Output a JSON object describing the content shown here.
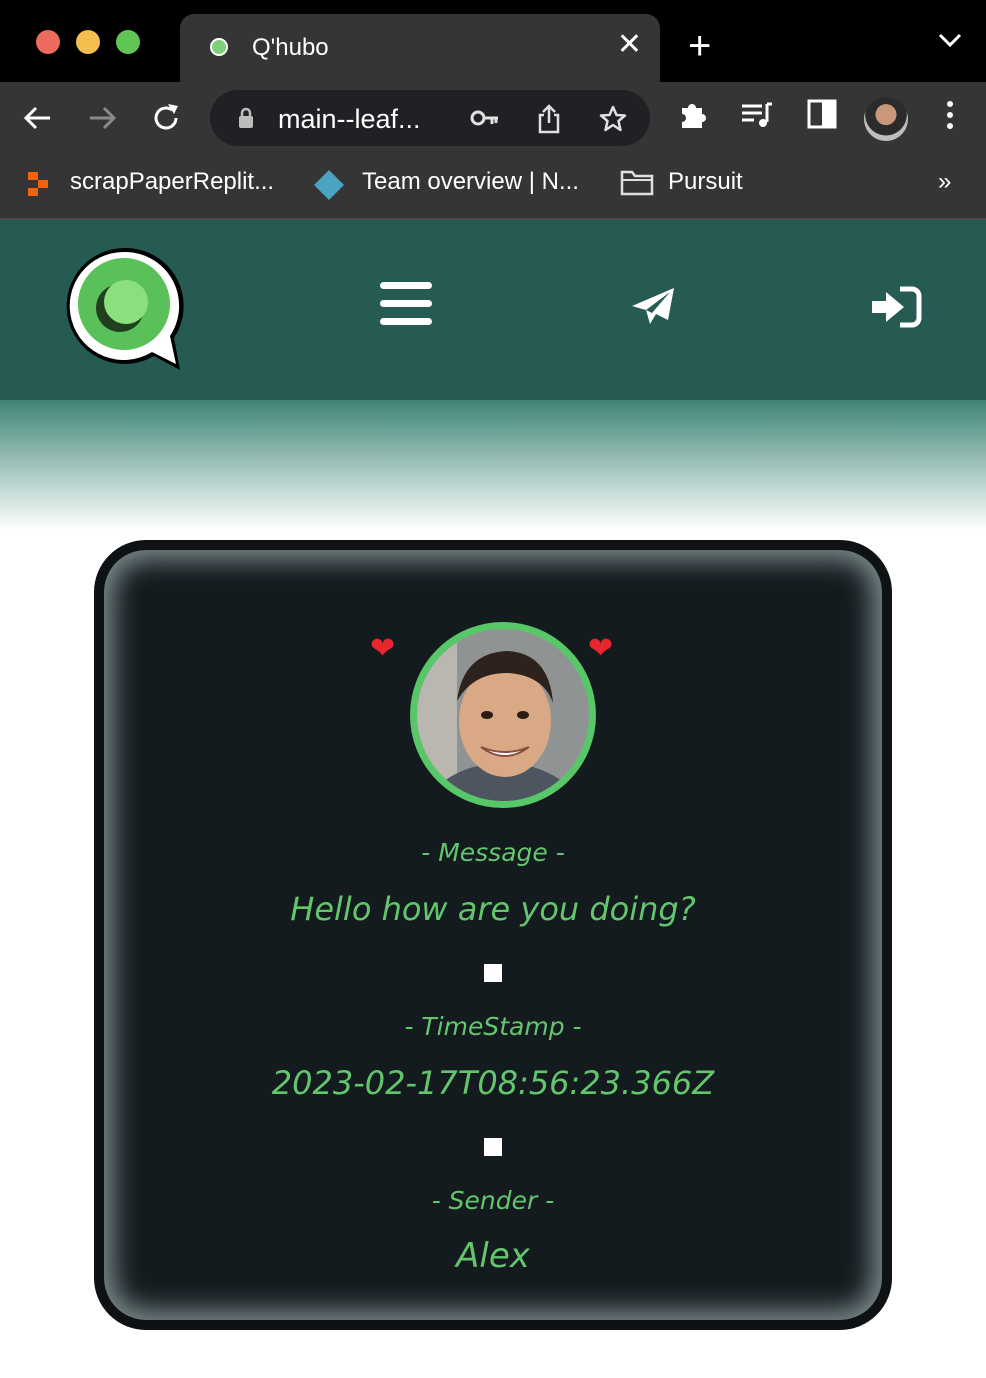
{
  "browser": {
    "tab_title": "Q'hubo",
    "tab_close": "✕",
    "new_tab": "+",
    "url": "main--leaf...",
    "bookmarks": [
      {
        "label": "scrapPaperReplit..."
      },
      {
        "label": "Team overview | N..."
      },
      {
        "label": "Pursuit"
      }
    ],
    "bookmarks_more": "»"
  },
  "colors": {
    "nav_bg": "#255b52",
    "card_bg": "#141b1f",
    "accent_green": "#63c66d"
  },
  "app": {
    "logo_icon": "chat-bubble-logo-icon",
    "menu_icon": "hamburger-menu-icon",
    "send_icon": "paper-plane-icon",
    "login_icon": "sign-in-icon"
  },
  "card": {
    "heart_left": "❤",
    "heart_right": "❤",
    "message_label": "- Message -",
    "message_value": "Hello how are you doing?",
    "timestamp_label": "- TimeStamp -",
    "timestamp_value": "2023-02-17T08:56:23.366Z",
    "sender_label": "- Sender -",
    "sender_value": "Alex"
  }
}
